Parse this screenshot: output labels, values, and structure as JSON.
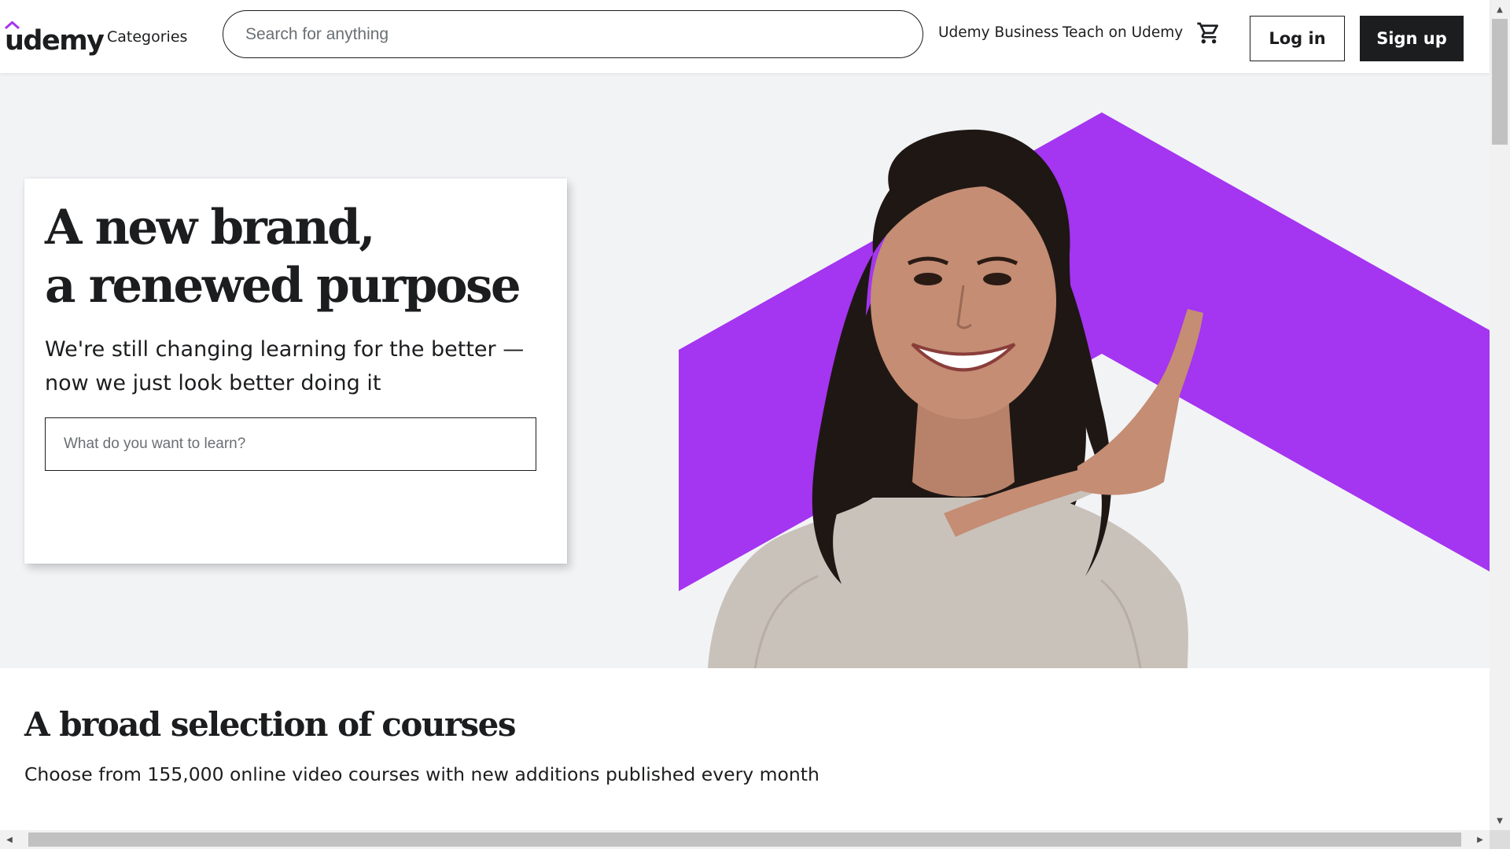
{
  "header": {
    "logo": "udemy",
    "categories_label": "Categories",
    "search_placeholder": "Search for anything",
    "udemy_business": "Udemy Business",
    "teach": "Teach on Udemy",
    "cart_icon": "shopping-cart-icon",
    "login_label": "Log in",
    "signup_label": "Sign up"
  },
  "hero": {
    "title_line1": "A new brand,",
    "title_line2": "a renewed purpose",
    "subtitle": "We're still changing learning for the better — now we just look better doing it",
    "search_placeholder": "What do you want to learn?",
    "accent_color": "#a435f0",
    "background_color": "#f2f3f5"
  },
  "courses": {
    "title": "A broad selection of courses",
    "subtitle": "Choose from 155,000 online video courses with new additions published every month"
  },
  "colors": {
    "brand_purple": "#a435f0",
    "text_dark": "#1c1d1f"
  }
}
